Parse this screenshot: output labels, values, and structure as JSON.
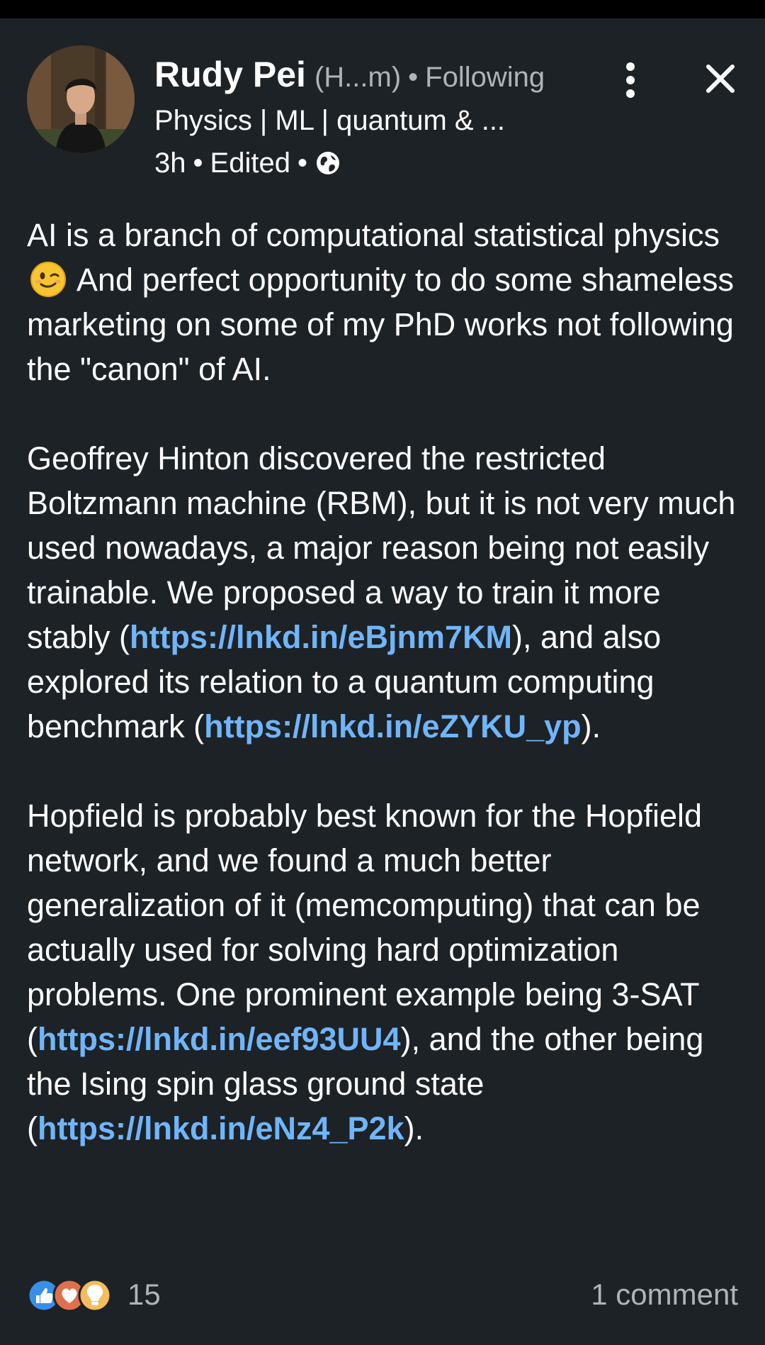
{
  "author": {
    "name": "Rudy Pei",
    "handle": "(H...m)",
    "follow_status": "Following",
    "headline": "Physics | ML | quantum & ...",
    "time": "3h",
    "edited": "Edited",
    "separator": "•"
  },
  "icons": {
    "avatar": "profile-photo",
    "visibility": "globe-icon",
    "more": "more-vertical-icon",
    "close": "close-icon",
    "emoji": "winking-face-emoji",
    "reactions": [
      "like-reaction-icon",
      "love-reaction-icon",
      "insightful-reaction-icon"
    ]
  },
  "post": {
    "p1_a": "AI is a branch of computational statistical physics",
    "p1_b": " And perfect opportunity to do some shameless marketing on some of my PhD works not following the \"canon\" of AI.",
    "p2_a": "Geoffrey Hinton discovered the restricted Boltzmann machine (RBM), but it is not very much used nowadays, a major reason being not easily trainable. We proposed a way to train it more stably (",
    "p2_link1": "https://lnkd.in/eBjnm7KM",
    "p2_b": "), and also explored its relation to a quantum computing benchmark (",
    "p2_link2": "https://lnkd.in/eZYKU_yp",
    "p2_c": ").",
    "p3_a": "Hopfield is probably best known for the Hopfield network, and we found a much better generalization of it (memcomputing) that can be actually used for solving hard optimization problems. One prominent example being 3-SAT (",
    "p3_link1": "https://lnkd.in/eef93UU4",
    "p3_b": "), and the other being the Ising spin glass ground state (",
    "p3_link2": "https://lnkd.in/eNz4_P2k",
    "p3_c": ")."
  },
  "footer": {
    "reaction_count": "15",
    "comment_count": "1 comment"
  },
  "colors": {
    "background": "#1d2226",
    "link": "#70b5f9",
    "muted": "#b0b3b8",
    "text": "#ffffff"
  }
}
